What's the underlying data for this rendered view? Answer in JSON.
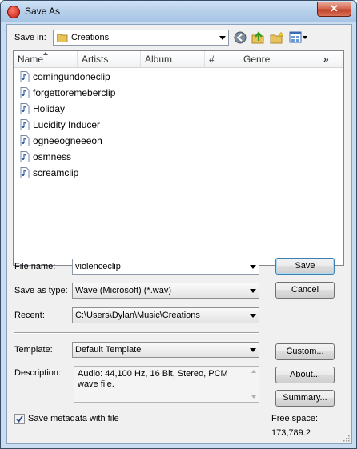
{
  "window": {
    "title": "Save As",
    "close_label": "✕"
  },
  "toolbar": {
    "save_in_label": "Save in:",
    "folder": "Creations"
  },
  "columns": [
    "Name",
    "Artists",
    "Album",
    "#",
    "Genre"
  ],
  "more_columns": "»",
  "files": [
    "comingundoneclip",
    "forgettoremeberclip",
    "Holiday",
    "Lucidity Inducer",
    "ogneeogneeeoh",
    "osmness",
    "screamclip"
  ],
  "form": {
    "file_name_label": "File name:",
    "file_name_value": "violenceclip",
    "save_type_label": "Save as type:",
    "save_type_value": "Wave (Microsoft) (*.wav)",
    "recent_label": "Recent:",
    "recent_value": "C:\\Users\\Dylan\\Music\\Creations",
    "template_label": "Template:",
    "template_value": "Default Template",
    "description_label": "Description:",
    "description_value": "Audio: 44,100 Hz, 16 Bit, Stereo, PCM wave file.",
    "metadata_label": "Save metadata with file",
    "metadata_checked": true
  },
  "buttons": {
    "save": "Save",
    "cancel": "Cancel",
    "custom": "Custom...",
    "about": "About...",
    "summary": "Summary..."
  },
  "free_space": {
    "label": "Free space:",
    "value": "173,789.2"
  }
}
